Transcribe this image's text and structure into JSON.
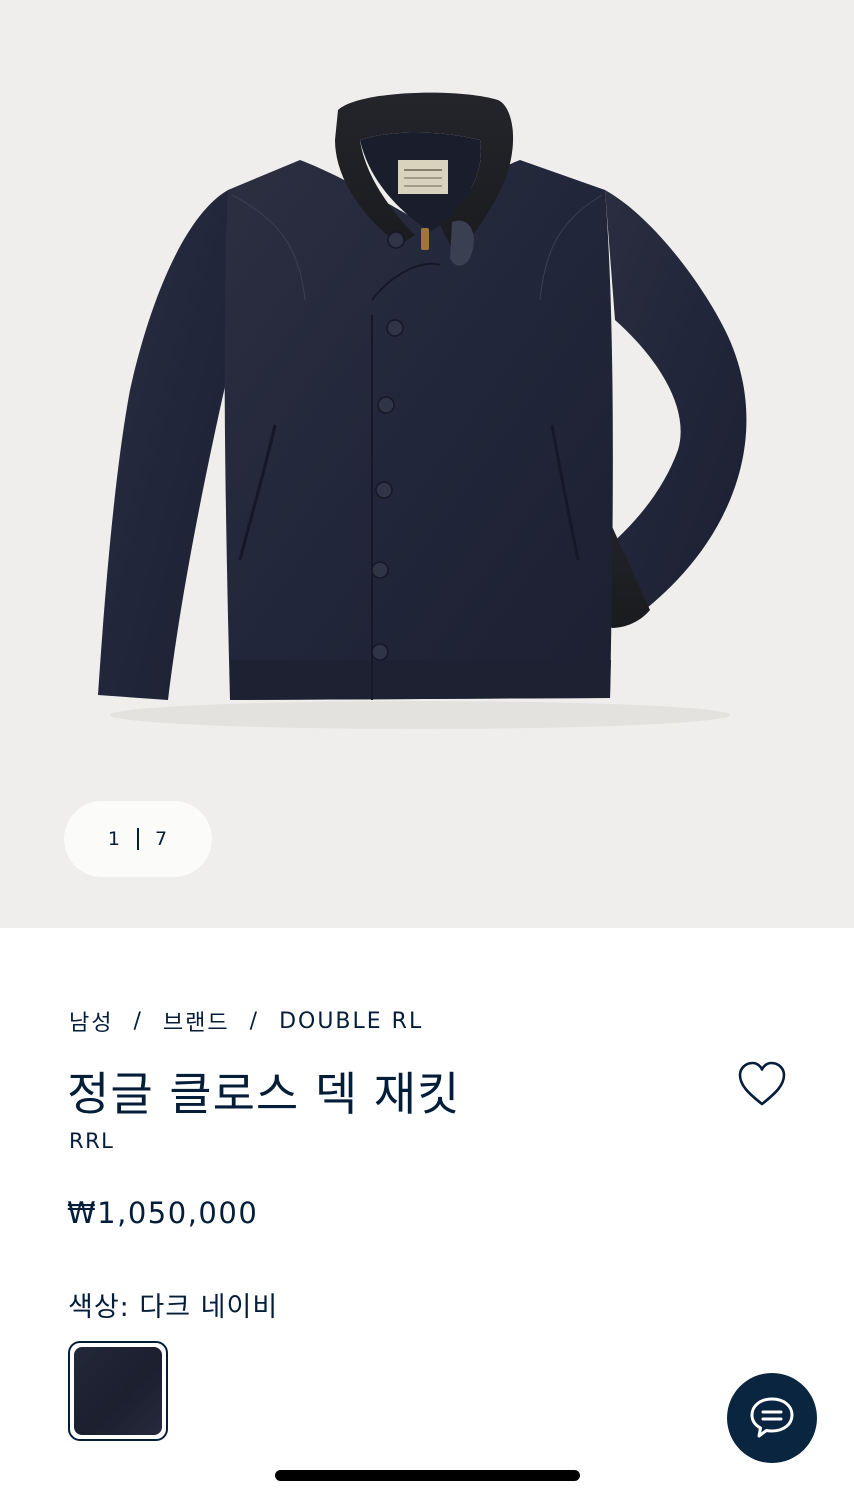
{
  "gallery": {
    "current_index": "1",
    "total": "7"
  },
  "breadcrumb": [
    "남성",
    "브랜드",
    "DOUBLE RL"
  ],
  "product": {
    "title": "정글 클로스 덱 재킷",
    "brand": "RRL",
    "price": "₩1,050,000",
    "color_label": "색상:",
    "color_value": "다크 네이비",
    "swatch_color": "#1f2332"
  },
  "colors": {
    "text": "#041e3a",
    "gallery_background": "#efeeec",
    "chat_button": "#0a2540"
  },
  "icons": {
    "wishlist": "heart-icon",
    "chat": "chat-bubble-icon"
  }
}
